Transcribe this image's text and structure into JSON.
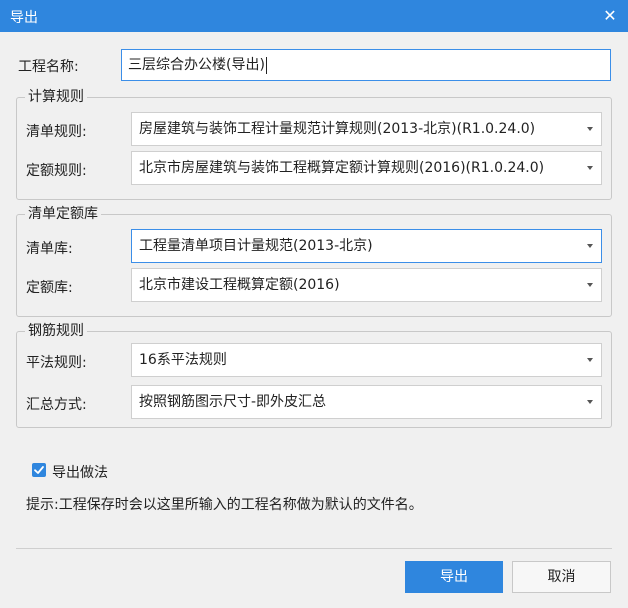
{
  "window": {
    "title": "导出",
    "close_glyph": "✕"
  },
  "project": {
    "label": "工程名称:",
    "value": "三层综合办公楼(导出)"
  },
  "calc_rules": {
    "legend": "计算规则",
    "list_rule_label": "清单规则:",
    "list_rule_value": "房屋建筑与装饰工程计量规范计算规则(2013-北京)(R1.0.24.0)",
    "quota_rule_label": "定额规则:",
    "quota_rule_value": "北京市房屋建筑与装饰工程概算定额计算规则(2016)(R1.0.24.0)"
  },
  "libraries": {
    "legend": "清单定额库",
    "list_lib_label": "清单库:",
    "list_lib_value": "工程量清单项目计量规范(2013-北京)",
    "quota_lib_label": "定额库:",
    "quota_lib_value": "北京市建设工程概算定额(2016)"
  },
  "rebar_rules": {
    "legend": "钢筋规则",
    "flat_rule_label": "平法规则:",
    "flat_rule_value": "16系平法规则",
    "summary_label": "汇总方式:",
    "summary_value": "按照钢筋图示尺寸-即外皮汇总"
  },
  "export_method": {
    "label": "导出做法",
    "checked": true
  },
  "hint": "提示:工程保存时会以这里所输入的工程名称做为默认的文件名。",
  "buttons": {
    "export": "导出",
    "cancel": "取消"
  },
  "colors": {
    "accent": "#2f86de",
    "focus_border": "#3b8ee8"
  }
}
